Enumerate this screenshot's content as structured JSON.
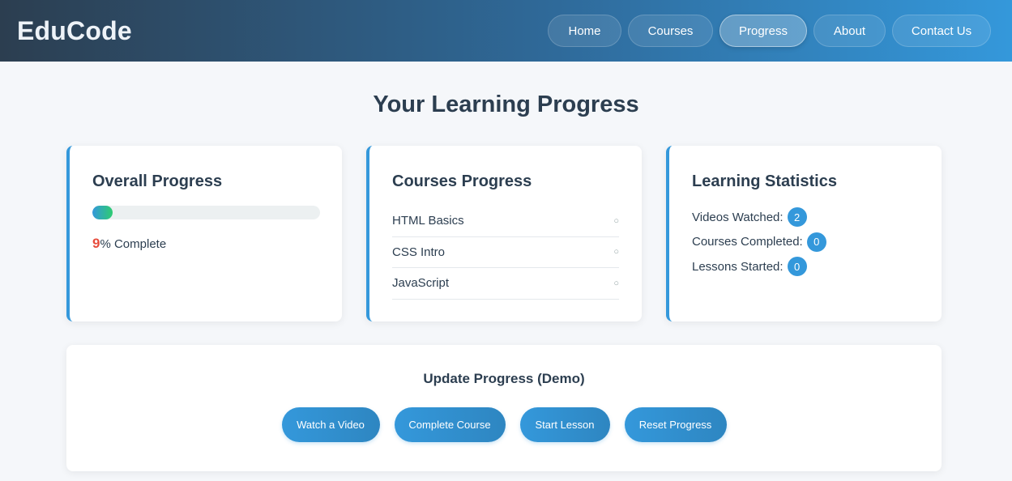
{
  "header": {
    "logo": "EduCode",
    "nav": [
      {
        "label": "Home",
        "active": false
      },
      {
        "label": "Courses",
        "active": false
      },
      {
        "label": "Progress",
        "active": true
      },
      {
        "label": "About",
        "active": false
      },
      {
        "label": "Contact Us",
        "active": false
      }
    ]
  },
  "page_title": "Your Learning Progress",
  "overall": {
    "title": "Overall Progress",
    "percent": 9,
    "percent_value": "9",
    "suffix": "% Complete"
  },
  "courses": {
    "title": "Courses Progress",
    "items": [
      {
        "label": "HTML Basics",
        "status": "○"
      },
      {
        "label": "CSS Intro",
        "status": "○"
      },
      {
        "label": "JavaScript",
        "status": "○"
      }
    ]
  },
  "stats": {
    "title": "Learning Statistics",
    "items": [
      {
        "label": "Videos Watched:",
        "value": "2"
      },
      {
        "label": "Courses Completed:",
        "value": "0"
      },
      {
        "label": "Lessons Started:",
        "value": "0"
      }
    ]
  },
  "demo": {
    "title": "Update Progress (Demo)",
    "buttons": [
      {
        "label": "Watch a Video"
      },
      {
        "label": "Complete Course"
      },
      {
        "label": "Start Lesson"
      },
      {
        "label": "Reset Progress"
      }
    ]
  },
  "colors": {
    "accent": "#3498db",
    "header_dark": "#2c3e50",
    "percent_red": "#e74c3c",
    "progress_green": "#2ecc71"
  }
}
